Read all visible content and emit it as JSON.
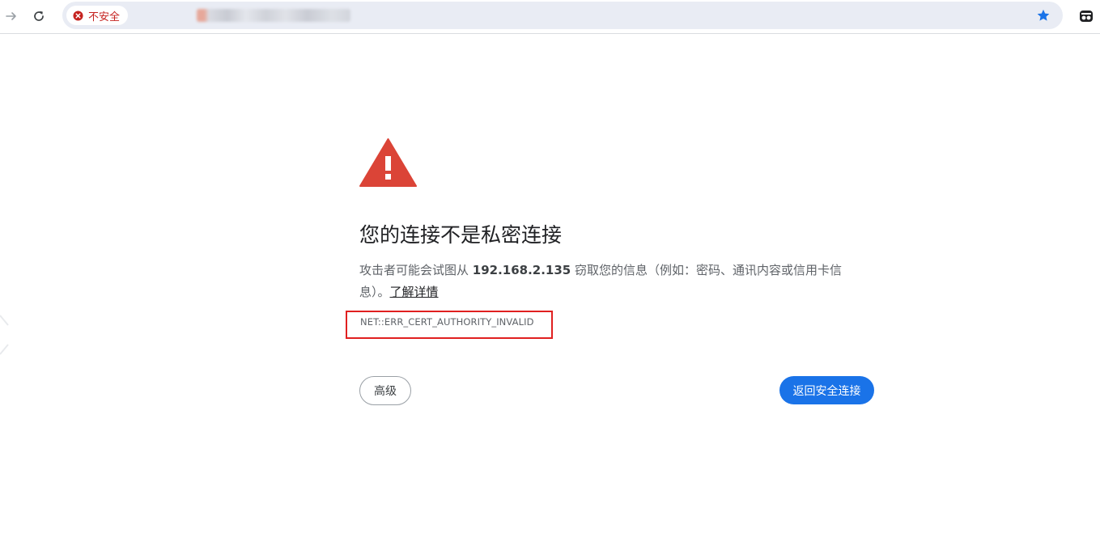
{
  "toolbar": {
    "back_icon": "arrow-forward-icon",
    "reload_icon": "reload-icon",
    "security_chip": {
      "icon": "error-circle-icon",
      "label": "不安全",
      "color": "#c5221f"
    },
    "bookmark_icon": "star-icon",
    "bookmark_color": "#1a73e8",
    "extension_icon": "incognito-icon"
  },
  "interstitial": {
    "warning_icon": "warning-triangle-icon",
    "warning_color": "#db4437",
    "title": "您的连接不是私密连接",
    "description_prefix": "攻击者可能会试图从 ",
    "host": "192.168.2.135",
    "description_suffix": " 窃取您的信息（例如：密码、通讯内容或信用卡信息）。",
    "learn_more": "了解详情",
    "error_code": "NET::ERR_CERT_AUTHORITY_INVALID",
    "advanced_button": "高级",
    "back_button": "返回安全连接",
    "accent_color": "#1a73e8"
  }
}
